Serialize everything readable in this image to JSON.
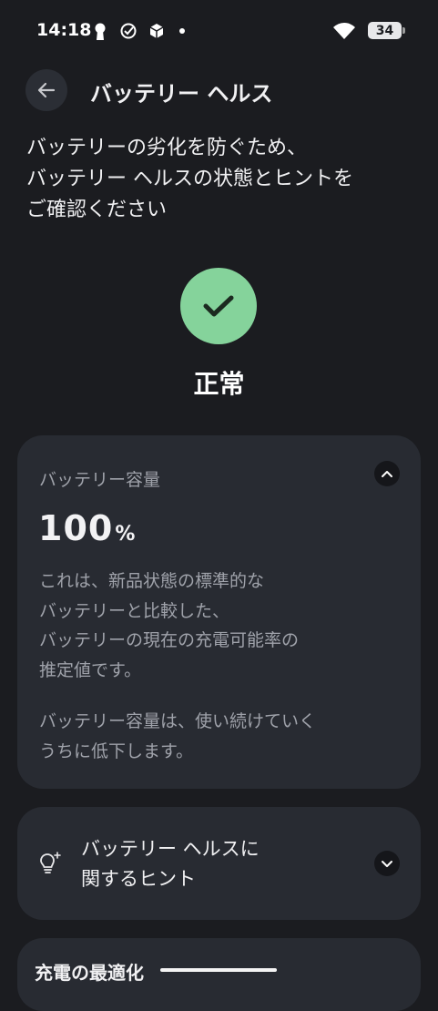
{
  "status_bar": {
    "time": "14:18",
    "battery_level": "34",
    "icons": [
      "keyhole-icon",
      "check-circle-icon",
      "cube-icon",
      "dot-icon",
      "wifi-icon",
      "battery-icon"
    ]
  },
  "header": {
    "title": "バッテリー ヘルス",
    "back_icon": "arrow-left-icon"
  },
  "intro": {
    "lines": [
      "バッテリーの劣化を防ぐため、",
      "バッテリー ヘルスの状態とヒントを",
      "ご確認ください"
    ]
  },
  "health": {
    "status": "正常",
    "status_color": "#85d39b"
  },
  "capacity_card": {
    "title": "バッテリー容量",
    "value": "100",
    "unit": "%",
    "description_lines": [
      "これは、新品状態の標準的な",
      "バッテリーと比較した、",
      "バッテリーの現在の充電可能率の",
      "推定値です。"
    ],
    "note_lines": [
      "バッテリー容量は、使い続けていく",
      "うちに低下します。"
    ],
    "expanded": true
  },
  "tips_card": {
    "title_lines": [
      "バッテリー ヘルスに",
      "関するヒント"
    ],
    "icon": "lightbulb-icon",
    "expanded": false
  },
  "charge_card": {
    "title": "充電の最適化"
  }
}
